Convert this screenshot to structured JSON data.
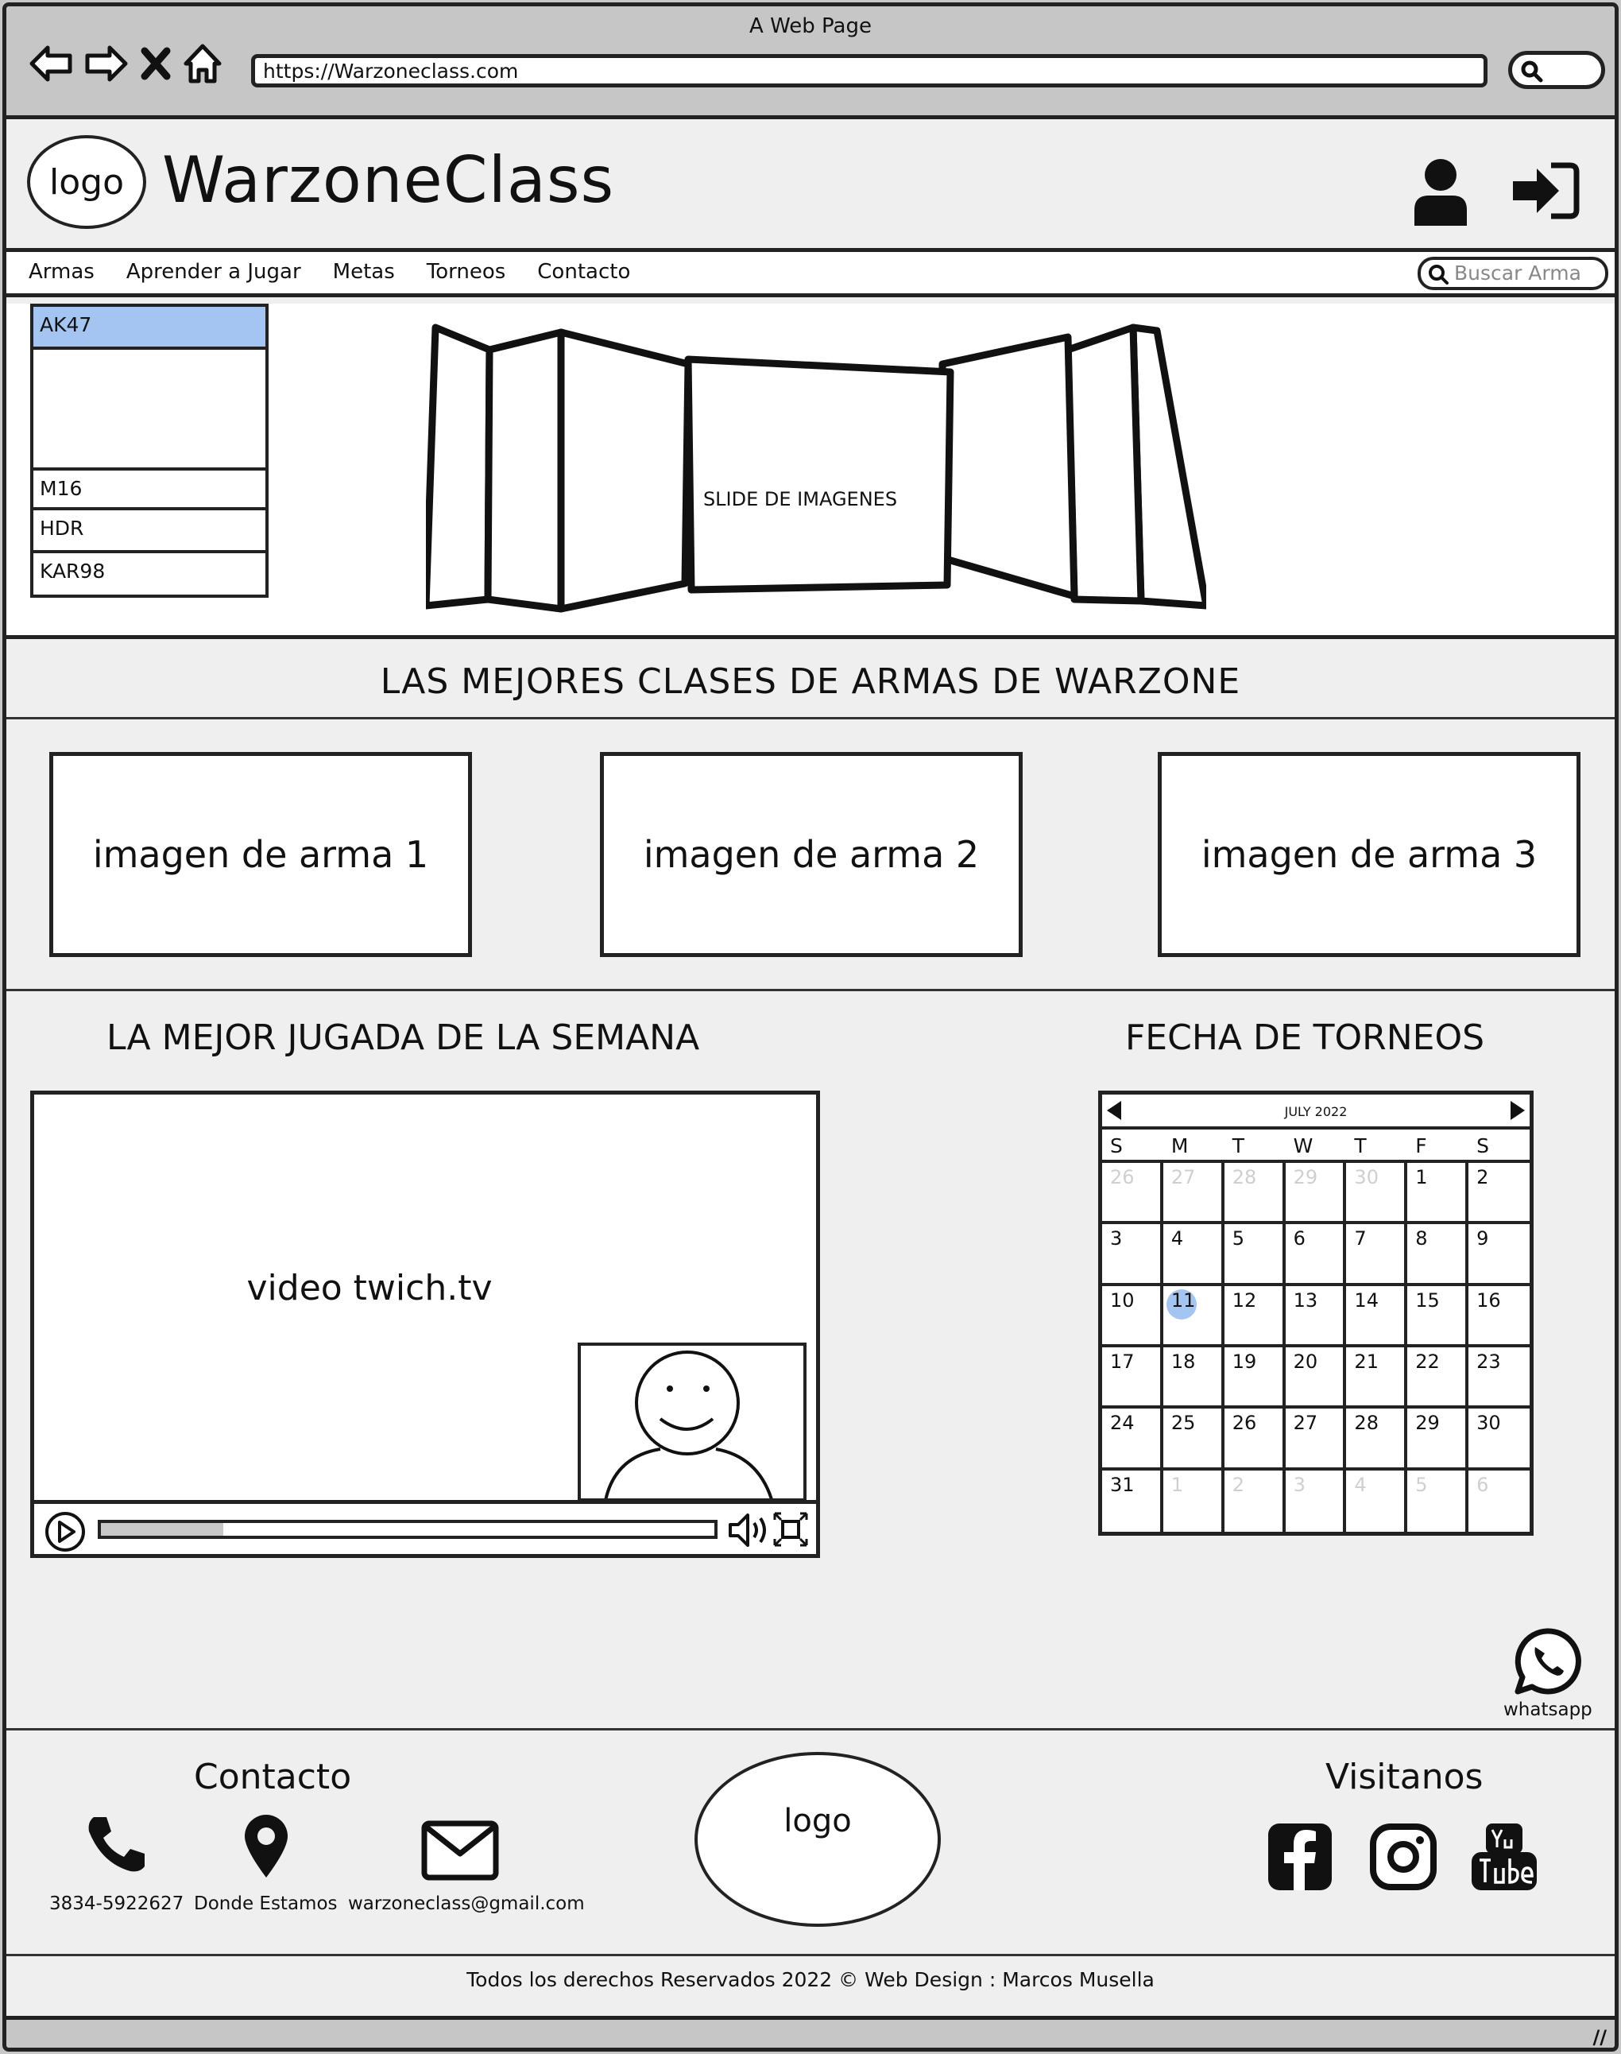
{
  "browser": {
    "window_title": "A Web Page",
    "url": "https://Warzoneclass.com"
  },
  "header": {
    "logo_text": "logo",
    "brand": "WarzoneClass"
  },
  "nav": {
    "items": [
      "Armas",
      "Aprender a Jugar",
      "Metas",
      "Torneos",
      "Contacto"
    ],
    "search_placeholder": "Buscar Arma"
  },
  "weapons": {
    "selected": "AK47",
    "items": [
      "M16",
      "HDR",
      "KAR98"
    ]
  },
  "slider": {
    "label": "SLIDE DE IMAGENES"
  },
  "best_classes": {
    "title": "LAS MEJORES CLASES DE ARMAS DE WARZONE",
    "cards": [
      "imagen de arma 1",
      "imagen de arma 2",
      "imagen de arma 3"
    ]
  },
  "video": {
    "title": "LA MEJOR JUGADA DE LA SEMANA",
    "label": "video twich.tv",
    "progress": 0.2
  },
  "calendar": {
    "title": "FECHA DE TORNEOS",
    "month": "JULY 2022",
    "weekdays": [
      "S",
      "M",
      "T",
      "W",
      "T",
      "F",
      "S"
    ],
    "leading_days": [
      "26",
      "27",
      "28",
      "29",
      "30"
    ],
    "days": [
      "1",
      "2",
      "3",
      "4",
      "5",
      "6",
      "7",
      "8",
      "9",
      "10",
      "11",
      "12",
      "13",
      "14",
      "15",
      "16",
      "17",
      "18",
      "19",
      "20",
      "21",
      "22",
      "23",
      "24",
      "25",
      "26",
      "27",
      "28",
      "29",
      "30",
      "31"
    ],
    "trailing_days": [
      "1",
      "2",
      "3",
      "4",
      "5",
      "6"
    ],
    "today": "11"
  },
  "whatsapp": {
    "label": "whatsapp"
  },
  "footer": {
    "contact_title": "Contacto",
    "phone": "3834-5922627",
    "location": "Donde Estamos",
    "email": "warzoneclass@gmail.com",
    "logo_text": "logo",
    "visit_title": "Visitanos",
    "copyright": "Todos los derechos Reservados 2022 © Web Design : Marcos Musella"
  },
  "icons": {
    "social": [
      "facebook-icon",
      "instagram-icon",
      "youtube-icon"
    ]
  }
}
